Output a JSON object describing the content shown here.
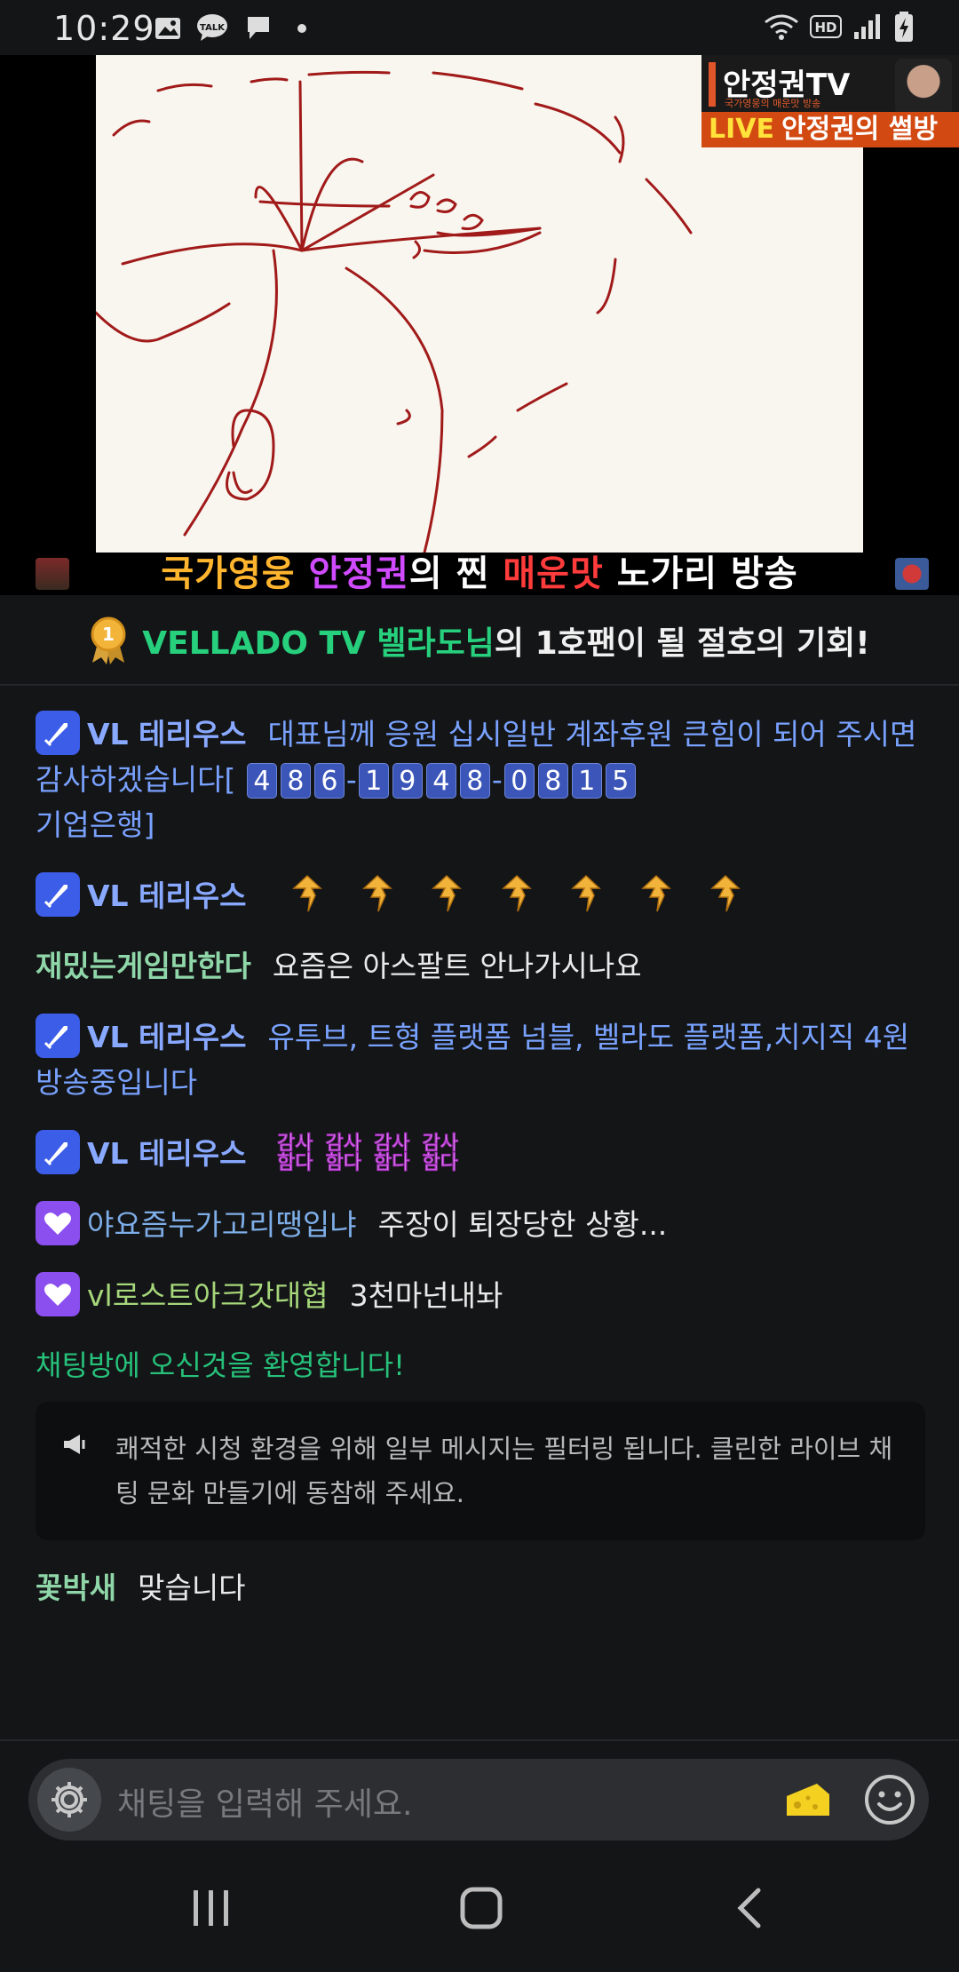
{
  "status_bar": {
    "time": "10:29"
  },
  "stream": {
    "logo_title": "안정권TV",
    "logo_sub": "국가영웅의 매운맛 방송",
    "live_label": "LIVE",
    "live_title": "안정권의 썰방",
    "caption_1": "국가영웅",
    "caption_2": "안정권",
    "caption_3": "의 찐 ",
    "caption_4": "매운맛",
    "caption_5": " 노가리 방송"
  },
  "promo": {
    "highlight": "VELLADO TV 벨라도님",
    "rest": "의 1호팬이 될 절호의 기회!"
  },
  "chat": {
    "messages": [
      {
        "nick": "VL 테리우스",
        "text_1": "대표님께 응원 십시일반 계좌후원 큰힘이 되어 주시면 감사하겠습니다[",
        "digits_a": [
          "4",
          "8",
          "6"
        ],
        "digits_b": [
          "1",
          "9",
          "4",
          "8"
        ],
        "digits_c": [
          "0",
          "8",
          "1",
          "5"
        ],
        "text_2": "기업은행]"
      },
      {
        "nick": "VL 테리우스"
      },
      {
        "nick": "재밌는게임만한다",
        "text": "요즘은 아스팔트 안나가시나요"
      },
      {
        "nick": "VL 테리우스",
        "text": "유투브, 트형 플랫폼 넘블, 벨라도 플랫폼,치지직 4원 방송중입니다"
      },
      {
        "nick": "VL 테리우스",
        "thanks_top": "감사",
        "thanks_bottom": "함다"
      },
      {
        "nick": "야요즘누가고리땡입냐",
        "text": "주장이 퇴장당한 상황..."
      },
      {
        "nick": "vl로스트아크갓대협",
        "text": "3천마넌내놔"
      },
      {
        "nick": "꽃박새",
        "text": "맞습니다"
      }
    ],
    "welcome": "채팅방에 오신것을 환영합니다!",
    "notice": "쾌적한 시청 환경을 위해 일부 메시지는 필터링 됩니다. 클린한 라이브 채팅 문화 만들기에 동참해 주세요."
  },
  "input": {
    "placeholder": "채팅을 입력해 주세요."
  }
}
